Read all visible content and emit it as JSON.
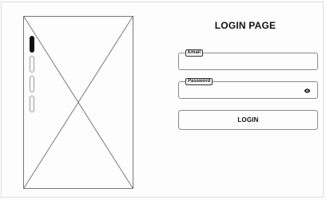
{
  "page": {
    "title": "LOGIN PAGE"
  },
  "carousel": {
    "active_index": 0,
    "total_dots": 4,
    "image_icon": "image-placeholder-icon"
  },
  "form": {
    "email": {
      "label": "Email",
      "value": ""
    },
    "password": {
      "label": "Password",
      "value": "",
      "toggle_icon": "eye-icon"
    },
    "login_label": "LOGIN"
  },
  "colors": {
    "text": "#111111",
    "border": "#8a8a8a",
    "background": "#fdfdfd"
  }
}
